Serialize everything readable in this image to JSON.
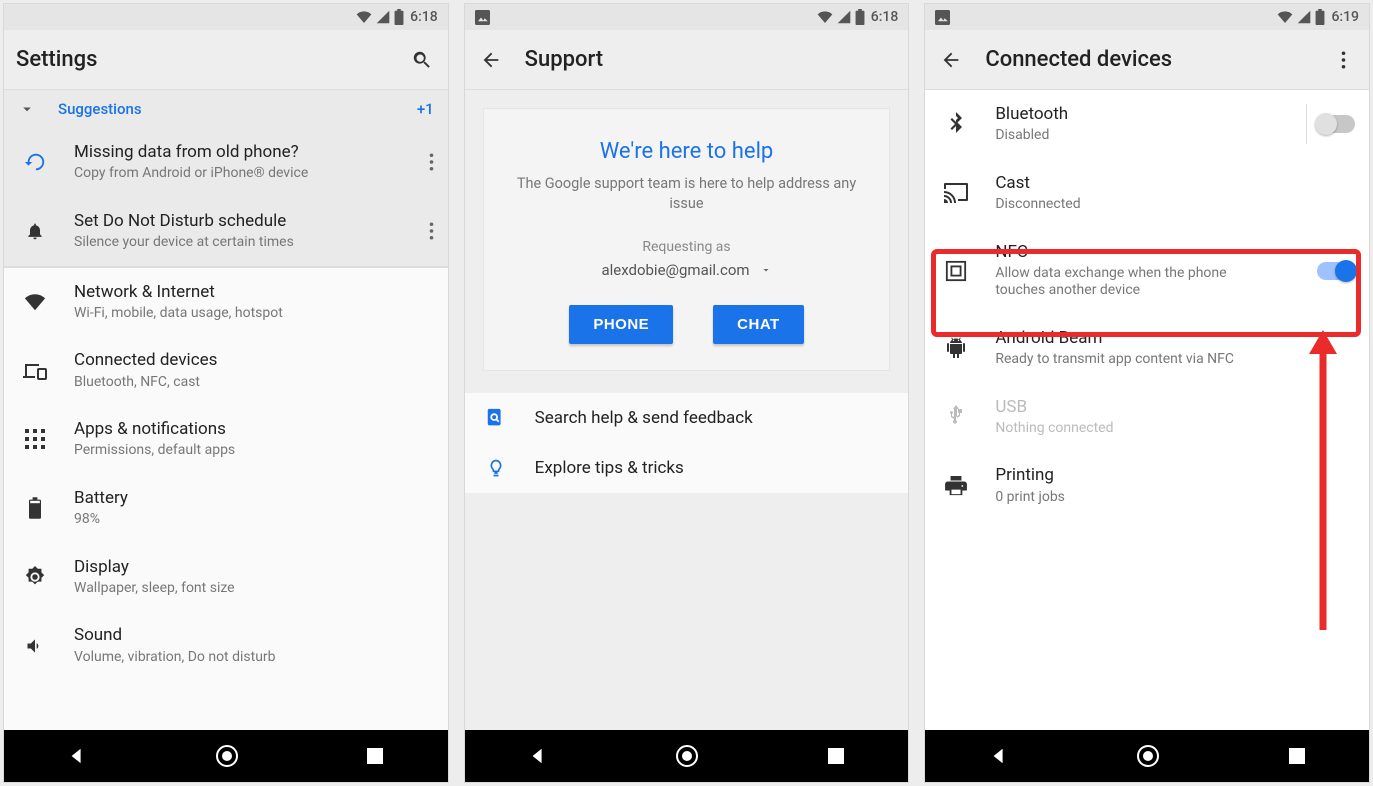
{
  "screen1": {
    "status": {
      "time": "6:18",
      "picture_icon": false
    },
    "title": "Settings",
    "suggestions_label": "Suggestions",
    "suggestions_count": "+1",
    "suggA": {
      "title": "Missing data from old phone?",
      "sub": "Copy from Android or iPhone® device"
    },
    "suggB": {
      "title": "Set Do Not Disturb schedule",
      "sub": "Silence your device at certain times"
    },
    "rows": [
      {
        "title": "Network & Internet",
        "sub": "Wi-Fi, mobile, data usage, hotspot"
      },
      {
        "title": "Connected devices",
        "sub": "Bluetooth, NFC, cast"
      },
      {
        "title": "Apps & notifications",
        "sub": "Permissions, default apps"
      },
      {
        "title": "Battery",
        "sub": "98%"
      },
      {
        "title": "Display",
        "sub": "Wallpaper, sleep, font size"
      },
      {
        "title": "Sound",
        "sub": "Volume, vibration, Do not disturb"
      }
    ]
  },
  "screen2": {
    "status": {
      "time": "6:18"
    },
    "title": "Support",
    "card": {
      "heading": "We're here to help",
      "body": "The Google support team is here to help address any issue",
      "req_label": "Requesting as",
      "email": "alexdobie@gmail.com",
      "btn_phone": "PHONE",
      "btn_chat": "CHAT"
    },
    "links": {
      "search": "Search help & send feedback",
      "tips": "Explore tips & tricks"
    }
  },
  "screen3": {
    "status": {
      "time": "6:19"
    },
    "title": "Connected devices",
    "rows": [
      {
        "key": "bluetooth",
        "title": "Bluetooth",
        "sub": "Disabled",
        "toggle": "off"
      },
      {
        "key": "cast",
        "title": "Cast",
        "sub": "Disconnected"
      },
      {
        "key": "nfc",
        "title": "NFC",
        "sub": "Allow data exchange when the phone touches another device",
        "toggle": "on"
      },
      {
        "key": "beam",
        "title": "Android Beam",
        "sub": "Ready to transmit app content via NFC"
      },
      {
        "key": "usb",
        "title": "USB",
        "sub": "Nothing connected",
        "dim": true
      },
      {
        "key": "printing",
        "title": "Printing",
        "sub": "0 print jobs"
      }
    ]
  }
}
